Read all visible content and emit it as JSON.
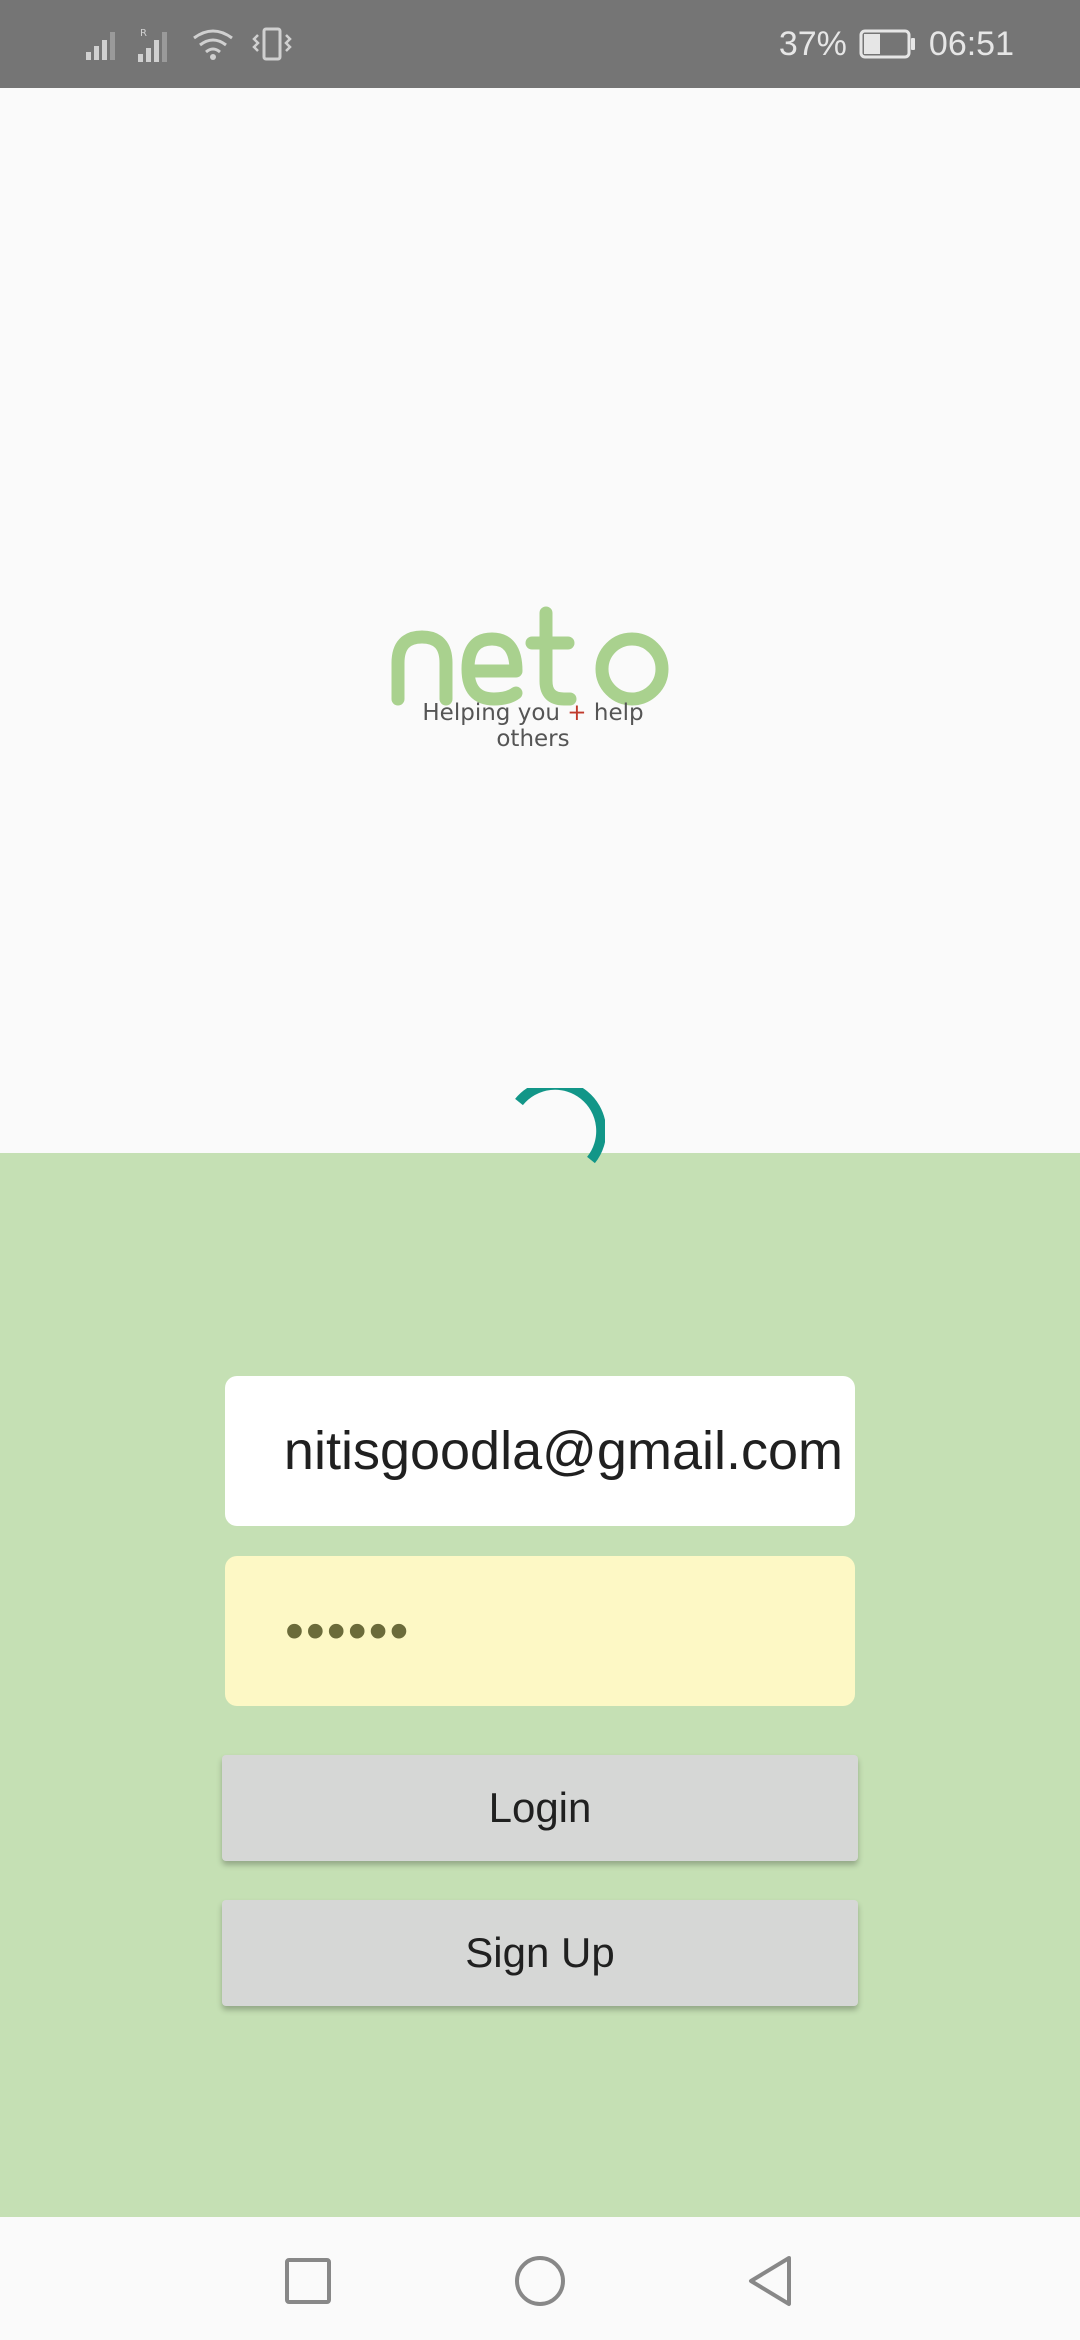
{
  "status_bar": {
    "battery_percent": "37%",
    "time": "06:51",
    "battery_level": 0.37
  },
  "logo": {
    "wordmark": "neto",
    "tagline_part1": "Helping you",
    "tagline_plus": "+",
    "tagline_part2": "help others",
    "color": "#a9d18e"
  },
  "login_form": {
    "email_value": "nitisgoodla@gmail.com",
    "password_value": "••••••",
    "login_label": "Login",
    "signup_label": "Sign Up"
  },
  "colors": {
    "status_bar": "#757575",
    "background": "#fafafa",
    "form_background": "#c5e0b4",
    "spinner": "#129688",
    "password_autofill": "#fdf8c5",
    "button": "#d6d7d6"
  }
}
